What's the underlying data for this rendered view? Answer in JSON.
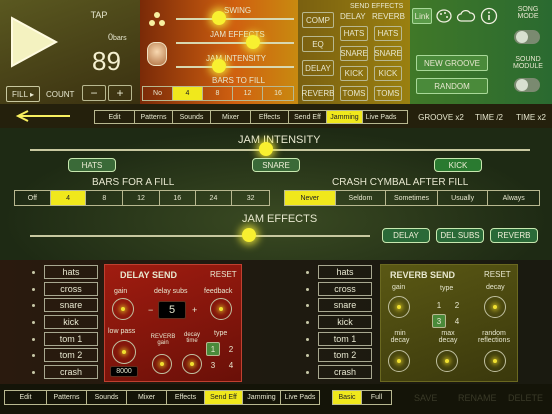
{
  "transport": {
    "tap": "TAP",
    "bars_count": "0",
    "bars_unit": "bars",
    "tempo": "89",
    "fill_label": "FILL ▸",
    "count_label": "COUNT",
    "minus": "−",
    "plus": "+"
  },
  "top_sliders": {
    "swing": "SWING",
    "jam_effects": "JAM EFFECTS",
    "jam_intensity": "JAM INTENSITY",
    "bars_to_fill": "BARS TO FILL"
  },
  "bars_to_fill_options": [
    "No",
    "4",
    "8",
    "12",
    "16"
  ],
  "effects": {
    "comp": "COMP",
    "eq": "EQ",
    "delay": "DELAY",
    "reverb": "REVERB"
  },
  "send_effects": {
    "title": "SEND EFFECTS",
    "delay_col": "DELAY",
    "reverb_col": "REVERB",
    "hats": "HATS",
    "snare": "SNARE",
    "kick": "KICK",
    "toms": "TOMS"
  },
  "groove": {
    "link": "Link",
    "new_groove": "NEW GROOVE",
    "random": "RANDOM",
    "song_mode": "SONG MODE",
    "song_module": "SOUND MODULE"
  },
  "nav_top": [
    "Edit",
    "Patterns",
    "Sounds",
    "Mixer",
    "Effects",
    "Send Eff",
    "Jamming",
    "Live Pads"
  ],
  "tempo_buttons": {
    "groove_x2": "GROOVE x2",
    "time_half": "TIME /2",
    "time_x2": "TIME x2"
  },
  "jamming": {
    "jam_intensity": "JAM INTENSITY",
    "hats": "HATS",
    "snare": "SNARE",
    "kick": "KICK",
    "bars_for_fill": "BARS FOR A FILL",
    "bars_options": [
      "Off",
      "4",
      "8",
      "12",
      "16",
      "24",
      "32"
    ],
    "crash_title": "CRASH CYMBAL AFTER FILL",
    "crash_options": [
      "Never",
      "Seldom",
      "Sometimes",
      "Usually",
      "Always"
    ],
    "jam_effects": "JAM EFFECTS",
    "delay": "DELAY",
    "del_subs": "DEL SUBS",
    "reverb": "REVERB"
  },
  "instruments_left": [
    "hats",
    "cross",
    "snare",
    "kick",
    "tom 1",
    "tom 2",
    "crash"
  ],
  "instruments_right": [
    "hats",
    "cross",
    "snare",
    "kick",
    "tom 1",
    "tom 2",
    "crash"
  ],
  "delay_send": {
    "title": "DELAY SEND",
    "reset": "RESET",
    "gain": "gain",
    "delay_subs": "delay subs",
    "feedback": "feedback",
    "minus": "−",
    "value": "5",
    "plus": "+",
    "low_pass": "low pass",
    "reverb_gain": "REVERB gain",
    "decay_time": "decay time",
    "type": "type",
    "type_options": [
      "1",
      "2",
      "3",
      "4"
    ],
    "freq": "8000"
  },
  "reverb_send": {
    "title": "REVERB SEND",
    "reset": "RESET",
    "gain": "gain",
    "type": "type",
    "decay": "decay",
    "type_options": [
      "1",
      "2",
      "3",
      "4"
    ],
    "min_decay": "min decay",
    "max_decay": "max decay",
    "random_reflections": "random reflections"
  },
  "nav_bottom": [
    "Edit",
    "Patterns",
    "Sounds",
    "Mixer",
    "Effects",
    "Send Eff",
    "Jamming",
    "Live Pads"
  ],
  "view_modes": [
    "Basic",
    "Full"
  ],
  "file_actions": {
    "save": "SAVE",
    "rename": "RENAME",
    "delete": "DELETE"
  },
  "colors": {
    "accent": "#f0e81c",
    "jam_bg": "#2f3a1e",
    "delay_bg": "#8a1a10",
    "reverb_bg": "#4a4810"
  }
}
